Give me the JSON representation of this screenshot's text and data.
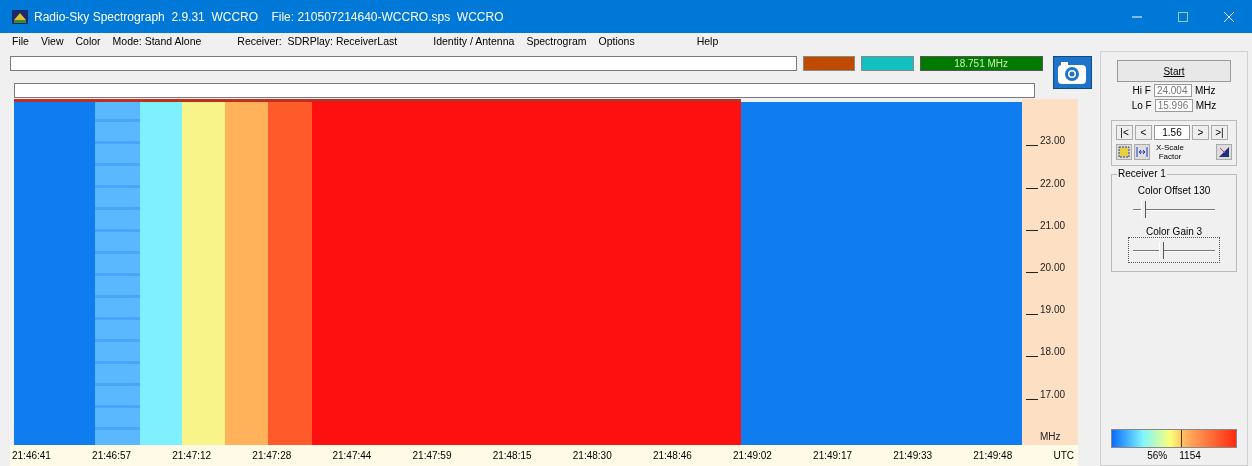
{
  "window": {
    "title": "Radio-Sky Spectrograph  2.9.31  WCCRO    File: 210507214640-WCCRO.sps  WCCRO"
  },
  "menu": [
    {
      "label": "File",
      "kind": "menu"
    },
    {
      "label": "View",
      "kind": "menu"
    },
    {
      "label": "Color",
      "kind": "menu"
    },
    {
      "label": "Mode: Stand Alone",
      "kind": "info"
    },
    {
      "label": "Receiver:  SDRPlay: ReceiverLast",
      "kind": "info"
    },
    {
      "label": "Identity / Antenna",
      "kind": "menu"
    },
    {
      "label": "Spectrogram",
      "kind": "menu"
    },
    {
      "label": "Options",
      "kind": "menu"
    },
    {
      "label": "Help",
      "kind": "help"
    }
  ],
  "toolbar": {
    "swatches": [
      {
        "color": "#c04a00"
      },
      {
        "color": "#13c0c0"
      }
    ],
    "frequency": "18.751 MHz"
  },
  "plot": {
    "freq_ticks": [
      "23.00",
      "22.00",
      "21.00",
      "20.00",
      "19.00",
      "18.00",
      "17.00"
    ],
    "freq_unit": "MHz",
    "times": [
      "21:46:41",
      "21:46:57",
      "21:47:12",
      "21:47:28",
      "21:47:44",
      "21:47:59",
      "21:48:15",
      "21:48:30",
      "21:48:46",
      "21:49:02",
      "21:49:17",
      "21:49:33",
      "21:49:48"
    ],
    "time_unit": "UTC"
  },
  "panel": {
    "start": "Start",
    "hi_label": "Hi F",
    "hi_value": "24.004",
    "lo_label": "Lo F",
    "lo_value": "15.996",
    "hi_unit": "MHz",
    "lo_unit": "MHz",
    "nav": [
      "|<",
      "<",
      ">",
      ">|"
    ],
    "scale_value": "1.56",
    "scale_label": "X-Scale Factor",
    "receiver": {
      "title": "Receiver 1",
      "sliders": [
        {
          "label": "Color Offset 130",
          "level": 0.1
        },
        {
          "label": "Color Gain 3",
          "level": 0.35
        }
      ]
    },
    "colorbar": {
      "level": 0.56,
      "percent": "56%",
      "value": "1154"
    }
  }
}
